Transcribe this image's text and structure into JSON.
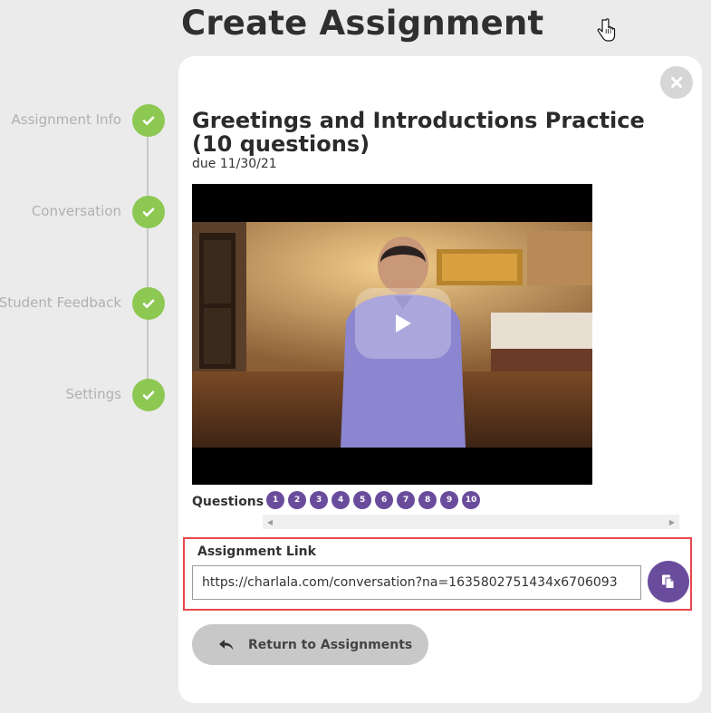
{
  "page": {
    "title": "Create Assignment"
  },
  "steps": [
    {
      "label": "Assignment Info",
      "status": "complete"
    },
    {
      "label": "Conversation",
      "status": "complete"
    },
    {
      "label": "Student Feedback",
      "status": "complete"
    },
    {
      "label": "Settings",
      "status": "complete"
    }
  ],
  "assignment": {
    "title": "Greetings and Introductions Practice (10 questions)",
    "due": "due 11/30/21"
  },
  "video": {
    "play_icon": "play-icon"
  },
  "questions": {
    "label": "Questions",
    "items": [
      "1",
      "2",
      "3",
      "4",
      "5",
      "6",
      "7",
      "8",
      "9",
      "10"
    ]
  },
  "link": {
    "label": "Assignment Link",
    "value": "https://charlala.com/conversation?na=1635802751434x6706093"
  },
  "return": {
    "label": "Return to Assignments"
  },
  "colors": {
    "accent": "#6a4c9c",
    "check": "#8dc853",
    "highlight": "#e8474c",
    "background": "#ebebeb"
  }
}
